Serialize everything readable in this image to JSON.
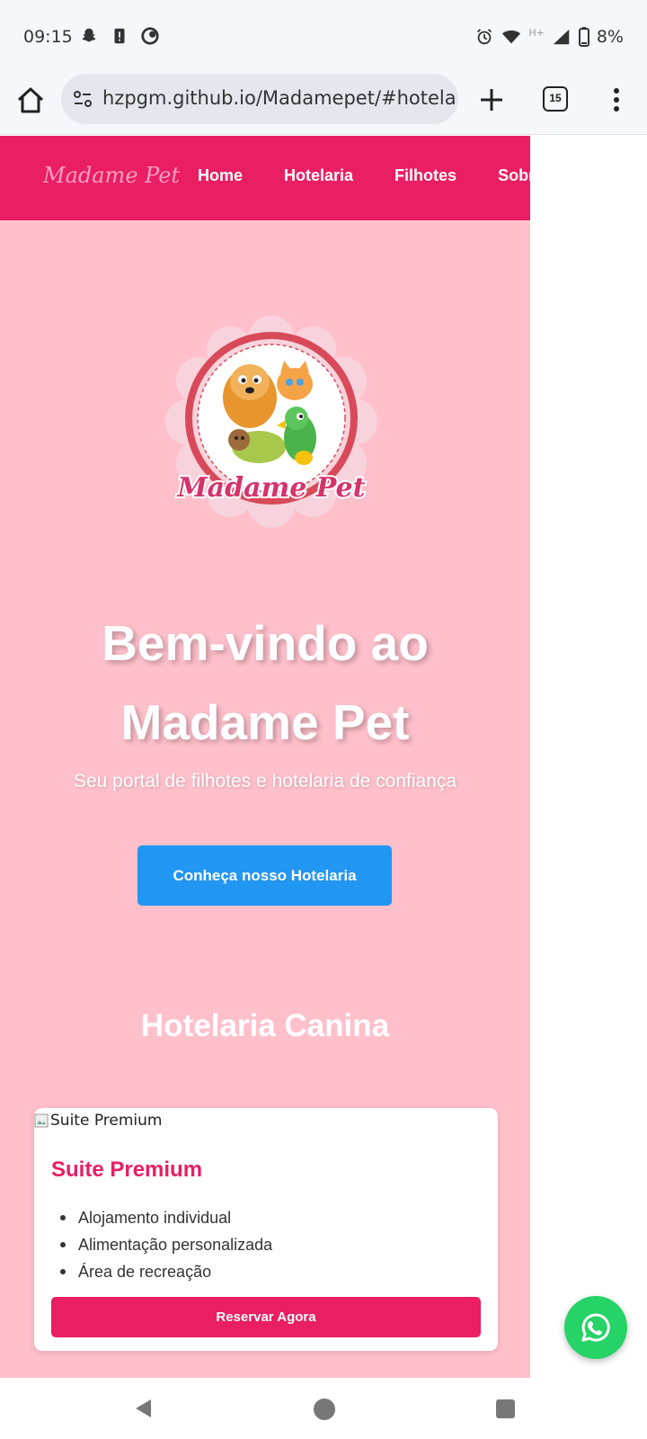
{
  "status_bar": {
    "time": "09:15",
    "network": "H+",
    "battery": "8%",
    "icons": [
      "snapchat-icon",
      "alert-icon",
      "sync-icon",
      "alarm-icon",
      "wifi-icon",
      "signal-icon",
      "battery-icon"
    ]
  },
  "browser": {
    "url": "hzpgm.github.io/Madamepet/#hotela",
    "tab_count": "15"
  },
  "site": {
    "brand": "Madame Pet",
    "nav": [
      "Home",
      "Hotelaria",
      "Filhotes",
      "Sobre"
    ],
    "colors": {
      "primary": "#e91e63",
      "background": "#ffc0cb",
      "cta": "#2196f3",
      "whatsapp": "#25d366"
    },
    "logo_text": "Madame Pet",
    "hero": {
      "title": "Bem-vindo ao Madame Pet",
      "subtitle": "Seu portal de filhotes e hotelaria de confiança",
      "cta": "Conheça nosso Hotelaria"
    },
    "section": {
      "title": "Hotelaria Canina",
      "card": {
        "image_alt": "Suite Premium",
        "title": "Suite Premium",
        "features": [
          "Alojamento individual",
          "Alimentação personalizada",
          "Área de recreação"
        ],
        "button": "Reservar Agora"
      }
    }
  }
}
